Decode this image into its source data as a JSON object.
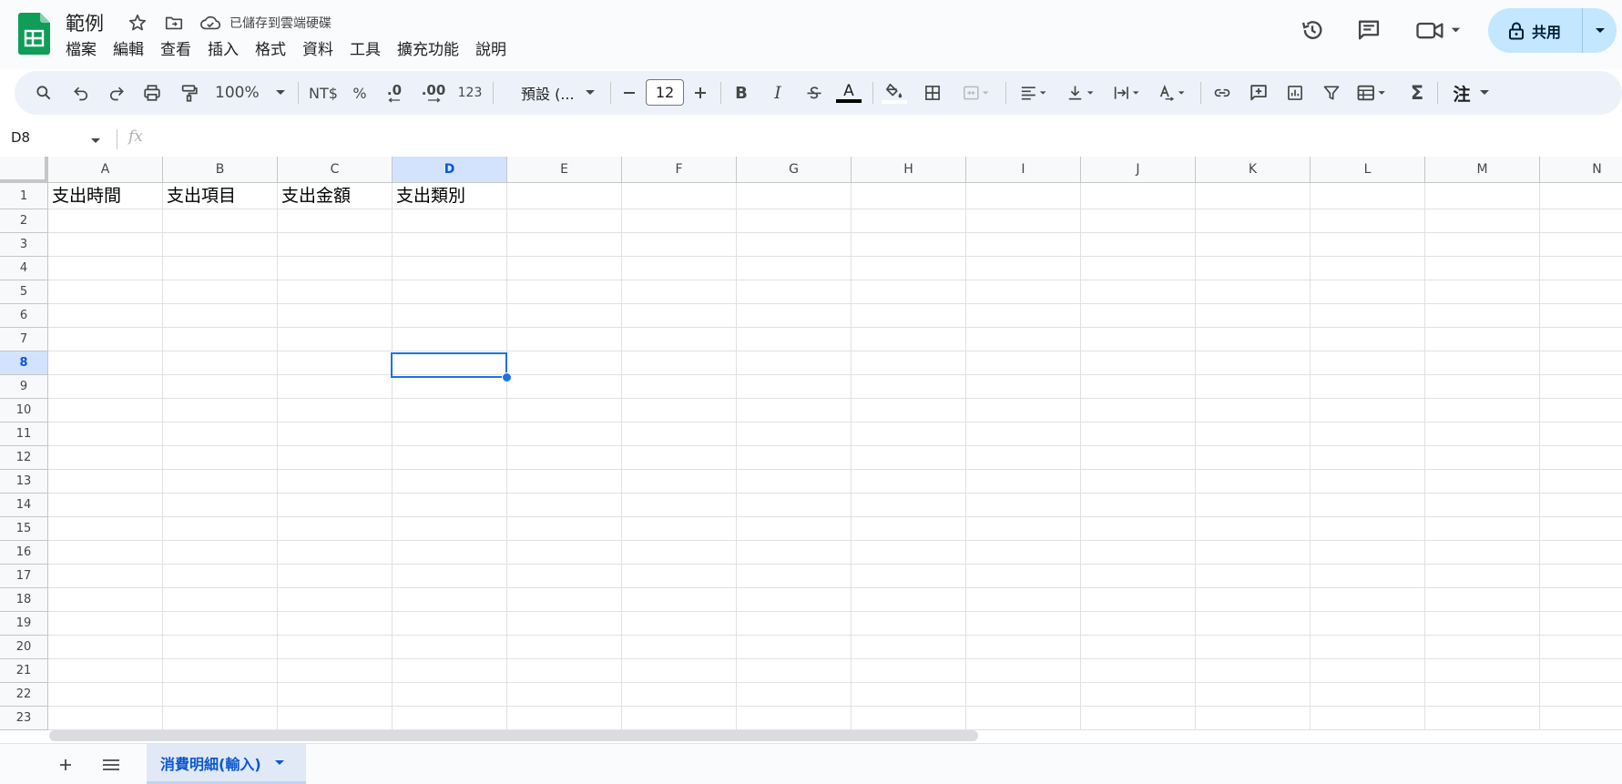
{
  "title_bar": {
    "doc_title": "範例",
    "save_status": "已儲存到雲端硬碟",
    "menu": [
      "檔案",
      "編輯",
      "查看",
      "插入",
      "格式",
      "資料",
      "工具",
      "擴充功能",
      "說明"
    ],
    "share_label": "共用"
  },
  "toolbar": {
    "zoom": "100%",
    "currency": "NT$",
    "percent": "%",
    "decrease_decimal": ".0",
    "increase_decimal": ".00",
    "number_format": "123",
    "font": "預設 (...",
    "font_size": "12",
    "bold": "B",
    "italic": "I",
    "text_color_glyph": "A",
    "sum_glyph": "Σ",
    "input_tools": "注"
  },
  "formula_bar": {
    "cell_ref": "D8",
    "fx": "fx"
  },
  "grid": {
    "columns": [
      "A",
      "B",
      "C",
      "D",
      "E",
      "F",
      "G",
      "H",
      "I",
      "J",
      "K",
      "L",
      "M",
      "N"
    ],
    "selected_column": "D",
    "rows": [
      "1",
      "2",
      "3",
      "4",
      "5",
      "6",
      "7",
      "8",
      "9",
      "10",
      "11",
      "12",
      "13",
      "14",
      "15",
      "16",
      "17",
      "18",
      "19",
      "20",
      "21",
      "22",
      "23"
    ],
    "selected_row": "8",
    "row1": [
      "支出時間",
      "支出項目",
      "支出金額",
      "支出類別"
    ],
    "active_cell": "D8"
  },
  "sheets": {
    "active_tab": "消費明細(輸入)"
  },
  "colors": {
    "accent_blue": "#1a73e8",
    "share_bg": "#c2e7ff",
    "toolbar_bg": "#edf2fa",
    "sheets_green": "#0f9d58",
    "selected_header_bg": "#d3e3fd"
  }
}
